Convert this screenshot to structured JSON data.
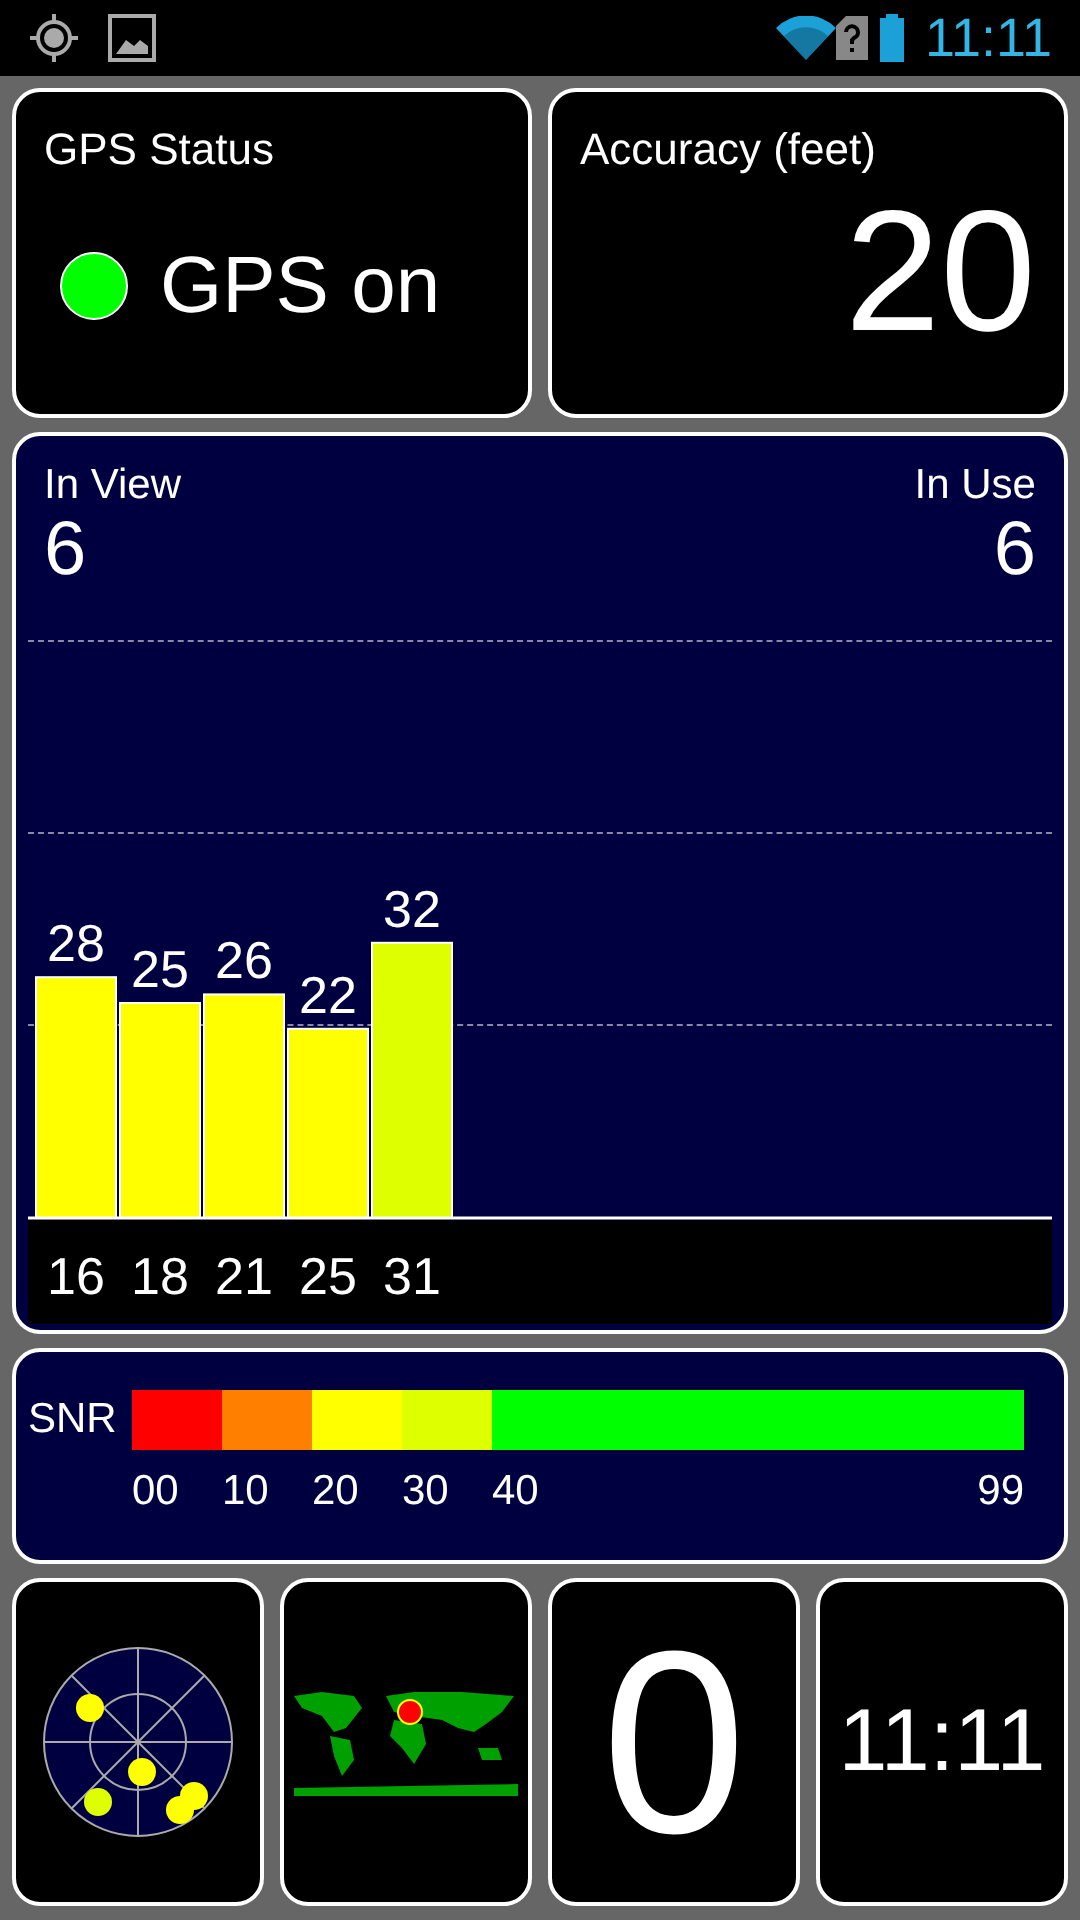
{
  "status_bar": {
    "time": "11:11"
  },
  "gps_status": {
    "title": "GPS Status",
    "value": "GPS on",
    "on": true
  },
  "accuracy": {
    "title": "Accuracy (feet)",
    "value": "20"
  },
  "satellites": {
    "in_view_label": "In View",
    "in_view": "6",
    "in_use_label": "In Use",
    "in_use": "6",
    "chart_data": {
      "type": "bar",
      "categories": [
        "16",
        "18",
        "21",
        "25",
        "31"
      ],
      "values": [
        28,
        25,
        26,
        22,
        32
      ],
      "data_labels": true
    }
  },
  "snr_legend": {
    "label": "SNR",
    "segments": [
      {
        "color": "#ff0000"
      },
      {
        "color": "#ff8000"
      },
      {
        "color": "#ffff00"
      },
      {
        "color": "#ddff00"
      },
      {
        "color": "#00ff00"
      }
    ],
    "ticks": [
      "00",
      "10",
      "20",
      "30",
      "40",
      "99"
    ]
  },
  "tiles": [
    {
      "kind": "radar"
    },
    {
      "kind": "map"
    },
    {
      "kind": "number",
      "value": "0"
    },
    {
      "kind": "clock",
      "value": "11:11"
    }
  ]
}
